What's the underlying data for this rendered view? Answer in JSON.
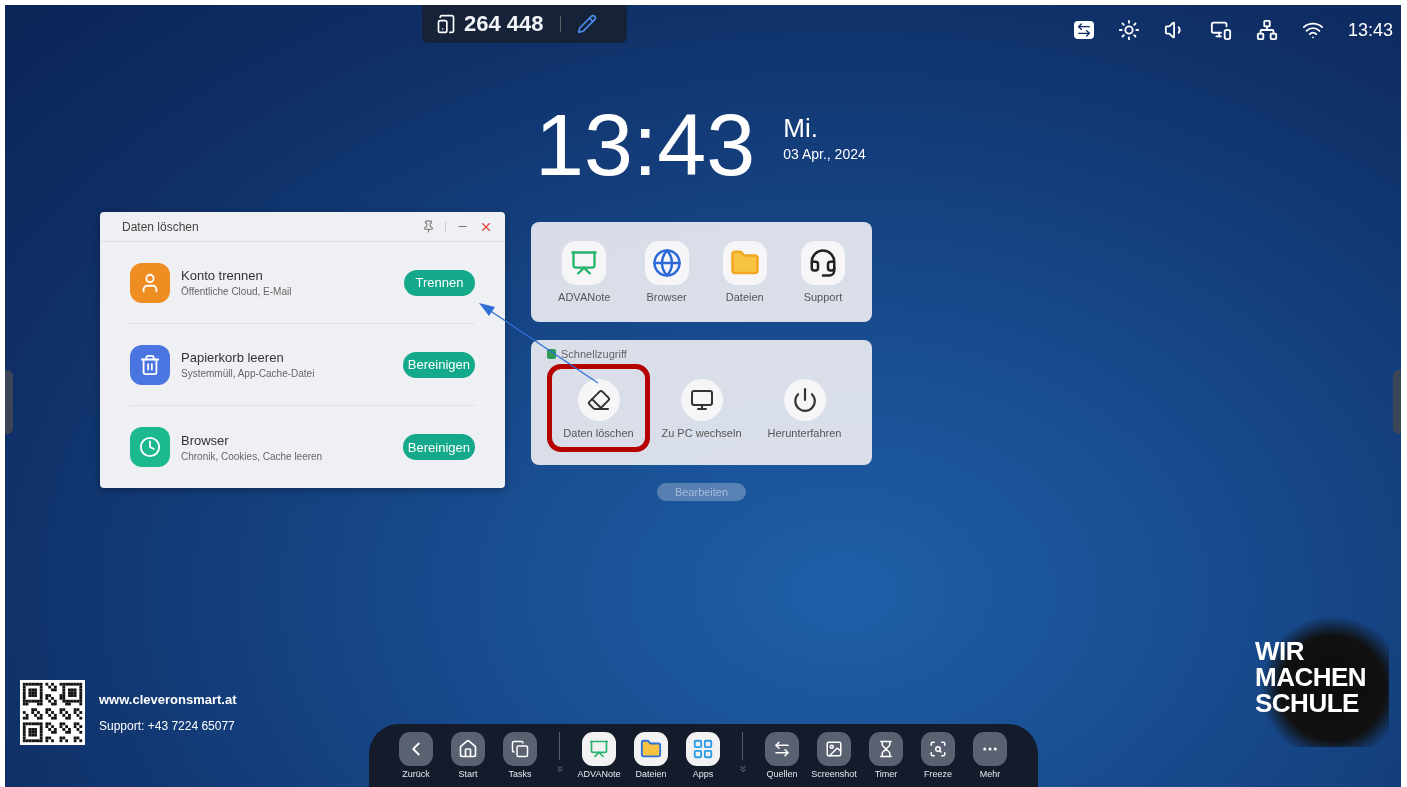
{
  "top_bar": {
    "counter": "264 448"
  },
  "status_bar": {
    "time": "13:43"
  },
  "clock": {
    "time": "13:43",
    "weekday": "Mi.",
    "date": "03 Apr., 2024"
  },
  "dialog": {
    "title": "Daten löschen",
    "items": [
      {
        "kind": "account",
        "title": "Konto trennen",
        "subtitle": "Öffentliche Cloud, E-Mail",
        "button": "Trennen"
      },
      {
        "kind": "trash",
        "title": "Papierkorb leeren",
        "subtitle": "Systemmüll, App-Cache-Datei",
        "button": "Bereinigen"
      },
      {
        "kind": "history",
        "title": "Browser",
        "subtitle": "Chronik, Cookies, Cache leeren",
        "button": "Bereinigen"
      }
    ]
  },
  "apps": [
    {
      "kind": "note",
      "label": "ADVANote"
    },
    {
      "kind": "globe",
      "label": "Browser"
    },
    {
      "kind": "folder",
      "label": "Dateien"
    },
    {
      "kind": "support",
      "label": "Support"
    }
  ],
  "quick_access": {
    "title": "Schnellzugriff",
    "items": [
      {
        "kind": "clean",
        "label": "Daten löschen",
        "highlighted": true
      },
      {
        "kind": "pc",
        "label": "Zu PC wechseln",
        "highlighted": false
      },
      {
        "kind": "power",
        "label": "Herunterfahren",
        "highlighted": false
      }
    ]
  },
  "edit_button": "Bearbeiten",
  "footer": {
    "website": "www.cleveronsmart.at",
    "support": "Support: +43 7224 65077"
  },
  "logo": [
    "WIR",
    "MACHEN",
    "SCHULE"
  ],
  "dock": {
    "groups": [
      [
        {
          "kind": "back",
          "label": "Zurück"
        },
        {
          "kind": "home",
          "label": "Start"
        },
        {
          "kind": "tasks",
          "label": "Tasks"
        }
      ],
      [
        {
          "kind": "note",
          "label": "ADVANote"
        },
        {
          "kind": "folder",
          "label": "Dateien"
        },
        {
          "kind": "apps",
          "label": "Apps"
        }
      ],
      [
        {
          "kind": "sources",
          "label": "Quellen"
        },
        {
          "kind": "screenshot",
          "label": "Screenshot"
        },
        {
          "kind": "timer",
          "label": "Timer"
        },
        {
          "kind": "freeze",
          "label": "Freeze"
        },
        {
          "kind": "more",
          "label": "Mehr"
        }
      ]
    ]
  }
}
